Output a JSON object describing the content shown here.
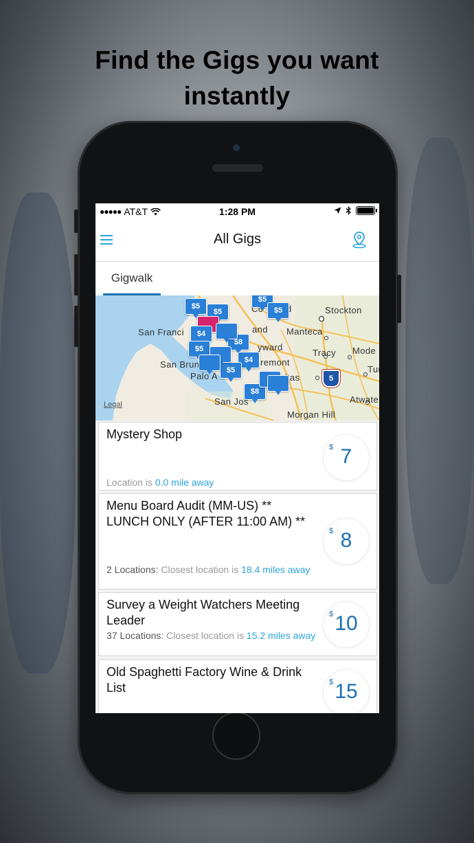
{
  "headline": {
    "line1": "Find the Gigs you want",
    "line2": "instantly"
  },
  "status_bar": {
    "carrier": "AT&T",
    "time": "1:28 PM",
    "icons": [
      "signal-dots-icon",
      "wifi-icon",
      "location-arrow-icon",
      "bluetooth-icon",
      "battery-icon"
    ]
  },
  "nav": {
    "title": "All Gigs",
    "left_icon": "hamburger-menu-icon",
    "right_icon": "map-pin-icon"
  },
  "tabs": [
    {
      "label": "Gigwalk",
      "selected": true
    }
  ],
  "map": {
    "labels": [
      {
        "text": "Stockton"
      },
      {
        "text": "San Franci"
      },
      {
        "text": "and"
      },
      {
        "text": "Manteca"
      },
      {
        "text": "yward"
      },
      {
        "text": "Tracy"
      },
      {
        "text": "Mode"
      },
      {
        "text": "San Bruno"
      },
      {
        "text": "remont"
      },
      {
        "text": "Palo A"
      },
      {
        "text": "pitas"
      },
      {
        "text": "Tur"
      },
      {
        "text": "San Jos"
      },
      {
        "text": "Atwate"
      },
      {
        "text": "Morgan Hill"
      },
      {
        "text": "Co"
      },
      {
        "text": "d"
      }
    ],
    "highway_shield": "5",
    "legal": "Legal",
    "markers": [
      {
        "label": "$5"
      },
      {
        "label": "$5"
      },
      {
        "label": "$5"
      },
      {
        "label": ""
      },
      {
        "label": "$5"
      },
      {
        "label": "$4"
      },
      {
        "label": "$8"
      },
      {
        "label": "$5"
      },
      {
        "label": "$4"
      },
      {
        "label": "$5"
      },
      {
        "label": "$8"
      },
      {
        "label": ""
      },
      {
        "label": ""
      },
      {
        "label": ""
      },
      {
        "label": ""
      },
      {
        "label": ""
      }
    ]
  },
  "gigs": [
    {
      "title": "Mystery Shop",
      "location_prefix": "Location is ",
      "location_highlight": "0.0 mile away",
      "location_label": "",
      "currency": "$",
      "price": "7"
    },
    {
      "title": "Menu Board Audit (MM-US) ** LUNCH ONLY (AFTER 11:00 AM) **",
      "location_label": "2 Locations:",
      "location_prefix": " Closest location is ",
      "location_highlight": "18.4 miles away",
      "currency": "$",
      "price": "8"
    },
    {
      "title": "Survey a Weight Watchers Meeting Leader",
      "location_label": "37 Locations:",
      "location_prefix": " Closest location is ",
      "location_highlight": "15.2 miles away",
      "currency": "$",
      "price": "10"
    },
    {
      "title": "Old Spaghetti Factory Wine & Drink List",
      "location_label": "",
      "location_prefix": "",
      "location_highlight": "",
      "currency": "$",
      "price": "15"
    }
  ],
  "colors": {
    "accent": "#2ea3d9",
    "price_blue": "#1e6fb0",
    "marker_blue": "#2a7fd6",
    "marker_pink": "#d6246e"
  }
}
